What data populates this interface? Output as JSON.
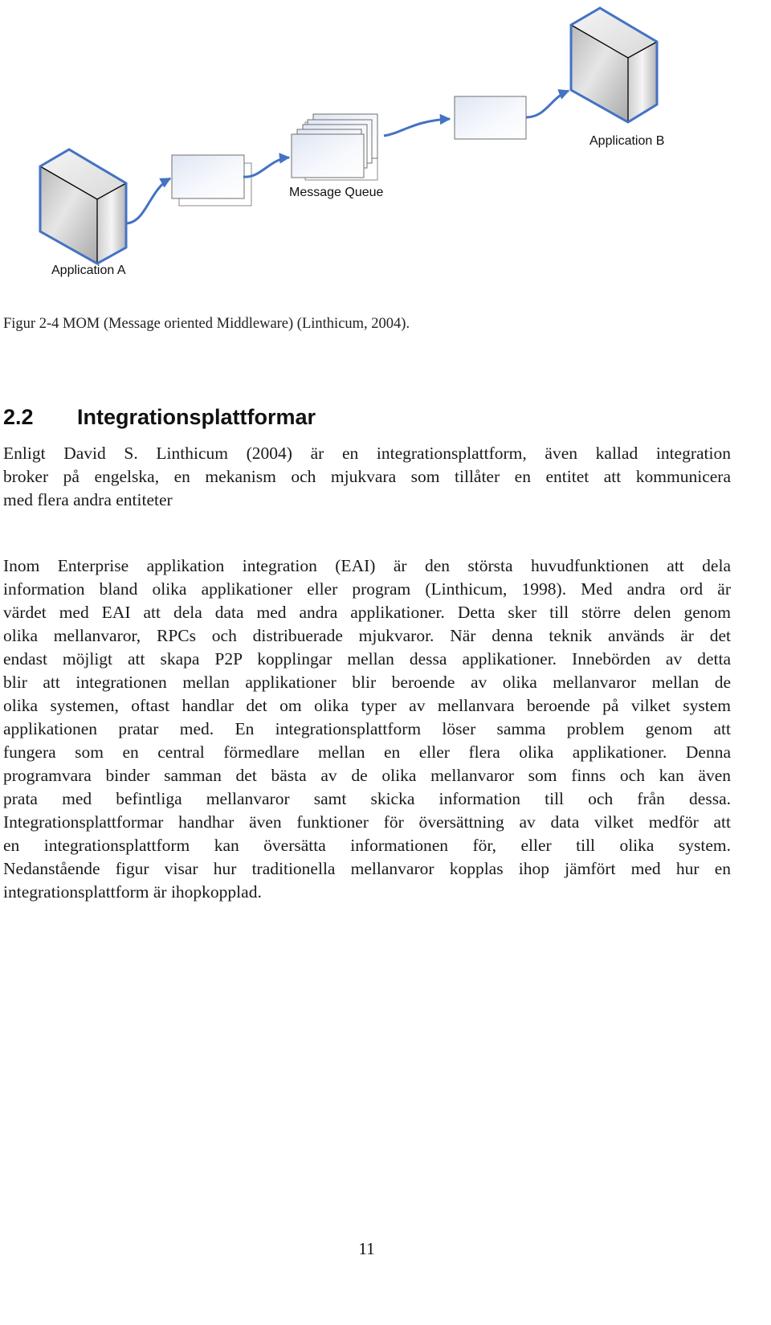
{
  "diagram": {
    "nodes": {
      "application_a": "Application A",
      "message_queue": "Message Queue",
      "application_b": "Application B"
    },
    "colors": {
      "accent_blue": "#4472c4",
      "box_border": "#7f7f7f",
      "cube_face": "#cfcfcf"
    }
  },
  "caption": "Figur 2-4 MOM (Message oriented Middleware) (Linthicum, 2004).",
  "section": {
    "number": "2.2",
    "title": "Integrationsplattformar"
  },
  "paragraphs": [
    {
      "lines": [
        "Enligt David S. Linthicum (2004) är en integrationsplattform, även kallad integration",
        "broker på engelska, en mekanism och mjukvara som tillåter en entitet att kommunicera",
        "med flera andra entiteter"
      ]
    },
    {
      "lines": [
        "Inom Enterprise applikation integration (EAI) är den största huvudfunktionen att dela",
        "information bland olika applikationer eller program (Linthicum, 1998). Med andra ord är",
        "värdet med EAI att dela data med andra applikationer. Detta sker till större delen genom",
        "olika mellanvaror, RPCs och distribuerade mjukvaror. När denna teknik används är det",
        "endast möjligt att skapa P2P kopplingar mellan dessa applikationer. Innebörden av detta",
        "blir att integrationen mellan applikationer blir beroende av olika mellanvaror mellan de",
        "olika systemen, oftast handlar det om olika typer av mellanvara beroende på vilket system",
        "applikationen pratar med. En integrationsplattform löser samma problem genom att",
        "fungera som en central förmedlare mellan en eller flera olika applikationer. Denna",
        "programvara binder samman det bästa av de olika mellanvaror som finns och kan även",
        "prata med befintliga mellanvaror samt skicka information till och från dessa.",
        "Integrationsplattformar handhar även funktioner för översättning av data vilket medför att",
        "en integrationsplattform kan översätta informationen för, eller till olika system.",
        "Nedanstående figur visar hur traditionella mellanvaror kopplas ihop jämfört med hur en",
        "integrationsplattform är ihopkopplad."
      ]
    }
  ],
  "page_number": "11"
}
